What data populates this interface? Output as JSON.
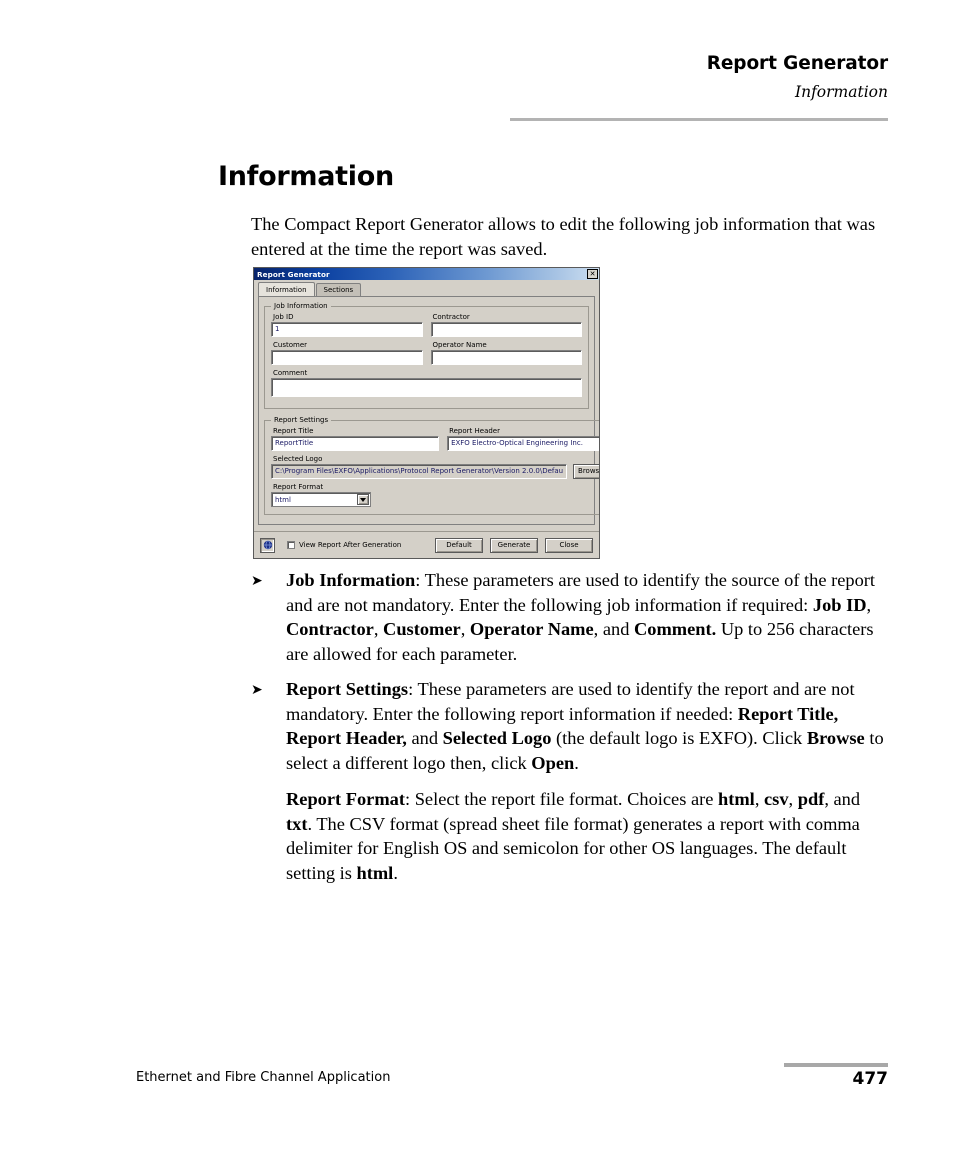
{
  "header": {
    "title": "Report Generator",
    "subtitle": "Information"
  },
  "page": {
    "heading": "Information",
    "intro": "The Compact Report Generator allows to edit the following job information that was entered at the time the report was saved."
  },
  "dialog": {
    "title": "Report Generator",
    "close_label": "✕",
    "tabs": [
      {
        "label": "Information",
        "active": true
      },
      {
        "label": "Sections",
        "active": false
      }
    ],
    "job_information": {
      "legend": "Job Information",
      "fields": [
        {
          "label": "Job ID",
          "value": "1"
        },
        {
          "label": "Contractor",
          "value": ""
        },
        {
          "label": "Customer",
          "value": ""
        },
        {
          "label": "Operator Name",
          "value": ""
        },
        {
          "label": "Comment",
          "value": ""
        }
      ]
    },
    "report_settings": {
      "legend": "Report Settings",
      "report_title": {
        "label": "Report Title",
        "value": "ReportTitle"
      },
      "report_header": {
        "label": "Report Header",
        "value": "EXFO Electro-Optical Engineering Inc."
      },
      "selected_logo": {
        "label": "Selected Logo",
        "value": "C:\\Program Files\\EXFO\\Applications\\Protocol Report Generator\\Version 2.0.0\\Defau",
        "browse_label": "Browse..."
      },
      "report_format": {
        "label": "Report Format",
        "value": "html",
        "options": [
          "html",
          "csv",
          "pdf",
          "txt"
        ]
      }
    },
    "footer": {
      "logo_icon": "exfo-globe-icon",
      "view_report_label": "View Report After Generation",
      "view_report_checked": false,
      "buttons": [
        "Default",
        "Generate",
        "Close"
      ]
    }
  },
  "bullets": [
    {
      "icon": "arrow-bullet-icon",
      "html": "<b>Job Information</b>: These parameters are used to identify the source of the report and are not mandatory. Enter the following job information if required: <b>Job ID</b>, <b>Contractor</b>, <b>Customer</b>, <b>Operator Name</b>, and <b>Comment.</b> Up to 256 characters are allowed for each parameter."
    },
    {
      "icon": "arrow-bullet-icon",
      "html": "<b>Report Settings</b>: These parameters are used to identify the report and are not mandatory. Enter the following report information if needed: <b>Report Title, Report Header,</b> and <b>Selected Logo</b> (the default logo is EXFO). Click <b>Browse</b> to select a different logo then, click <b>Open</b>."
    }
  ],
  "paragraphs": [
    {
      "html": "<b>Report Format</b>: Select the report file format. Choices are <b>html</b>, <b>csv</b>, <b>pdf</b>, and <b>txt</b>. The CSV format (spread sheet file format) generates a report with comma delimiter for English OS and semicolon for other OS languages. The default setting is <b>html</b>."
    }
  ],
  "footer": {
    "document_title": "Ethernet and Fibre Channel Application",
    "page_number": "477"
  }
}
